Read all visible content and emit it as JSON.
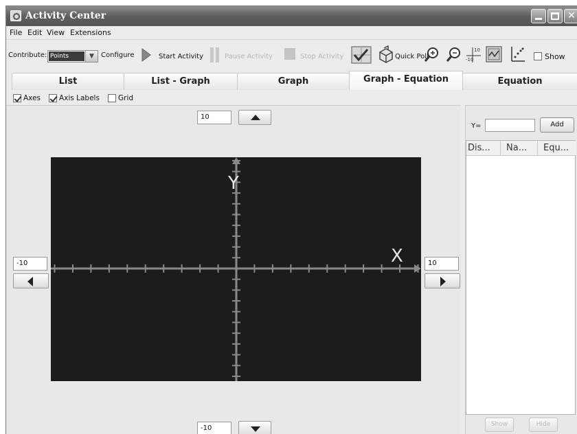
{
  "window": {
    "title": "Activity Center",
    "controls": [
      "minimize",
      "maximize",
      "close"
    ]
  },
  "menu": {
    "items": [
      "File",
      "Edit",
      "View",
      "Extensions"
    ]
  },
  "toolbar": {
    "contribute_label": "Contribute:",
    "contribute_value": "Points",
    "configure_label": "Configure",
    "start_label": "Start Activity",
    "pause_label": "Pause Activity",
    "stop_label": "Stop Activity",
    "quick_poll_label": "Quick Poll",
    "axis_range_top": "10",
    "axis_range_bottom": "-10",
    "show_label": "Show",
    "show_checked": false
  },
  "tabs": [
    {
      "label": "List",
      "active": false
    },
    {
      "label": "List - Graph",
      "active": false
    },
    {
      "label": "Graph",
      "active": false
    },
    {
      "label": "Graph - Equation",
      "active": true
    },
    {
      "label": "Equation",
      "active": false
    }
  ],
  "options": {
    "axes_label": "Axes",
    "axes_checked": true,
    "axis_labels_label": "Axis Labels",
    "axis_labels_checked": true,
    "grid_label": "Grid",
    "grid_checked": false
  },
  "graph": {
    "y_max": "10",
    "y_min": "-10",
    "x_min": "-10",
    "x_max": "10",
    "x_axis_label": "X",
    "y_axis_label": "Y",
    "background_color": "#1c1c1c",
    "axis_color": "#8a8a8a"
  },
  "equation_panel": {
    "y_prefix": "Y=",
    "input_value": "",
    "add_label": "Add",
    "columns": [
      "Dis...",
      "Na...",
      "Equ..."
    ],
    "show_label": "Show",
    "hide_label": "Hide"
  }
}
